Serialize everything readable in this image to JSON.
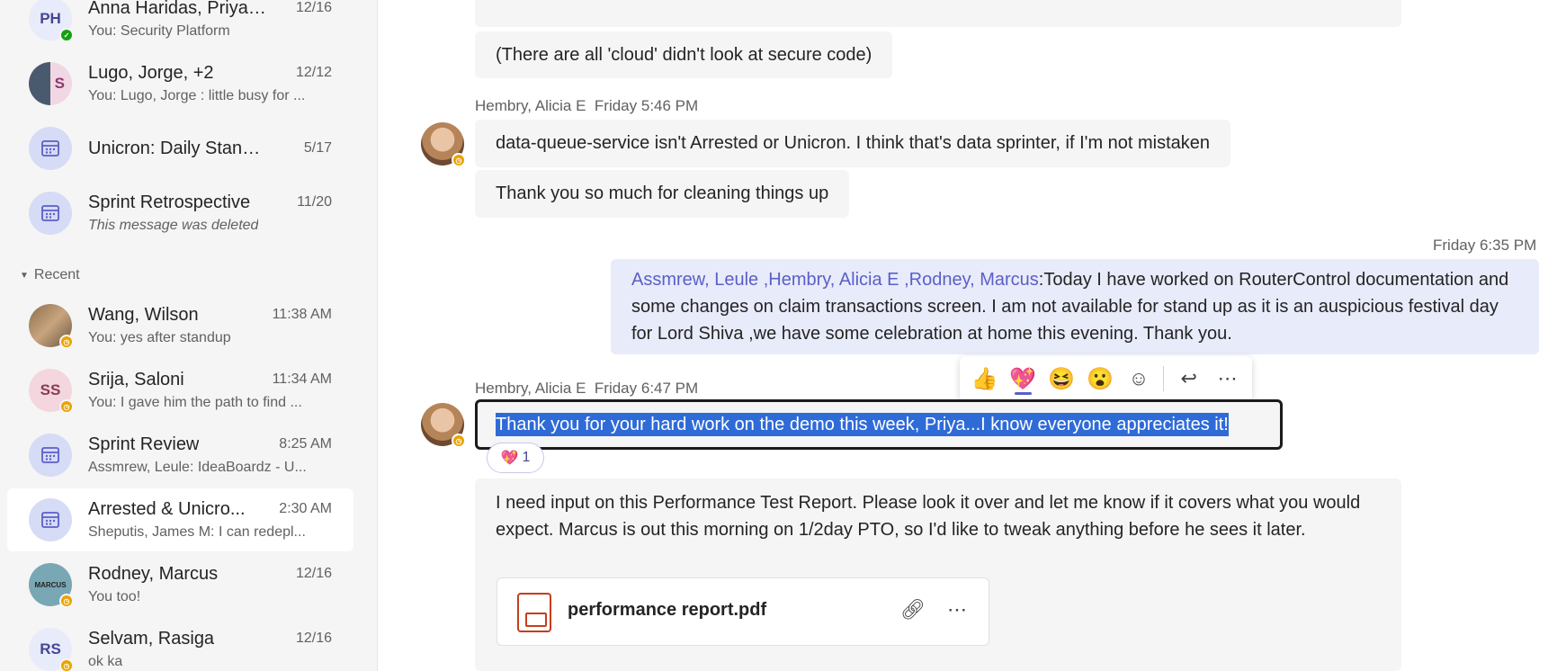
{
  "sidebar": {
    "chats_top": [
      {
        "initials": "PH",
        "name": "Anna Haridas, Priyat...",
        "time": "12/16",
        "preview": "You: Security Platform",
        "presence": "available"
      },
      {
        "initials": "S",
        "name": "Lugo, Jorge, +2",
        "time": "12/12",
        "preview": "You: Lugo, Jorge : little busy for ..."
      },
      {
        "name": "Unicron: Daily Stand Up",
        "time": "5/17",
        "icon": "calendar-icon"
      },
      {
        "name": "Sprint Retrospective",
        "time": "11/20",
        "preview": "This message was deleted",
        "icon": "calendar-icon"
      }
    ],
    "recent_label": "Recent",
    "recent": [
      {
        "name": "Wang, Wilson",
        "time": "11:38 AM",
        "preview": "You: yes after standup",
        "presence": "away"
      },
      {
        "initials": "SS",
        "name": "Srija, Saloni",
        "time": "11:34 AM",
        "preview": "You: I gave him the path to find ...",
        "presence": "away"
      },
      {
        "name": "Sprint Review",
        "time": "8:25 AM",
        "preview": "Assmrew, Leule: IdeaBoardz - U...",
        "icon": "calendar-icon"
      },
      {
        "name": "Arrested & Unicro...",
        "time": "2:30 AM",
        "preview": "Sheputis, James M: I can redepl...",
        "icon": "calendar-icon",
        "active": true
      },
      {
        "name": "Rodney, Marcus",
        "time": "12/16",
        "preview": "You too!",
        "presence": "away",
        "avatar_text": "MARCUS"
      },
      {
        "initials": "RS",
        "name": "Selvam, Rasiga",
        "time": "12/16",
        "preview": "ok ka",
        "presence": "away"
      }
    ]
  },
  "conversation": {
    "msg_cloud": "(There are all 'cloud' didn't look at secure code)",
    "sender1": "Hembry, Alicia E",
    "time1": "Friday 5:46 PM",
    "msg_dqs": "data-queue-service isn't Arrested or Unicron. I think that's data sprinter, if I'm not mistaken",
    "msg_thanks": "Thank you so much for cleaning things up",
    "self_time": "Friday 6:35 PM",
    "self_mentions": [
      "Assmrew, Leule",
      " ,Hembry, Alicia E",
      " ,Rodney, Marcus"
    ],
    "self_text": ":Today I have worked on RouterControl documentation and some changes on claim transactions screen. I am not available for stand up as it is an auspicious festival day for Lord Shiva ,we have some celebration at home this evening. Thank you.",
    "sender2": "Hembry, Alicia E",
    "time2": "Friday 6:47 PM",
    "selected_msg": "Thank you for your hard work on the demo this week, Priya...I know everyone appreciates it!",
    "reaction_count": "1",
    "msg_perf": "I need input on this Performance Test Report. Please look it over and let me know if it covers what you would expect. Marcus is out this morning on 1/2day PTO, so I'd like to tweak anything before he sees it later.",
    "file_name": "performance report.pdf"
  },
  "reactions": {
    "like": "👍",
    "heart": "💖",
    "laugh": "😆",
    "surprised": "😮",
    "add": "☺",
    "reply": "↩",
    "more": "⋯"
  },
  "colors": {
    "accent": "#5b5fc7",
    "selection": "#2f6bd7",
    "away": "#eaa300",
    "available": "#13a10e"
  }
}
